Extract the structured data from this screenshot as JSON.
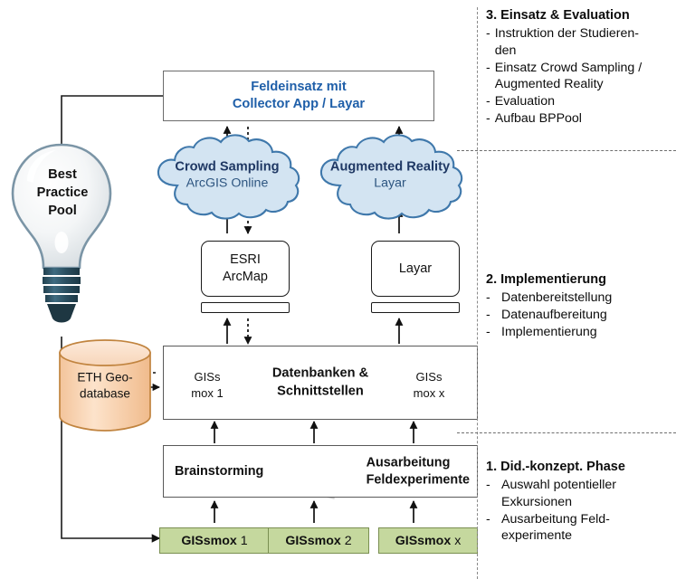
{
  "diagram": {
    "title": "GISsmox project workflow diagram",
    "colors": {
      "accent_blue": "#1f5fa9",
      "cloud_fill": "#d3e4f2",
      "cloud_stroke": "#3f78ab",
      "cloud_text": "#1f3864",
      "cylinder_fill": "#f8d3b0",
      "cylinder_stroke": "#c1843f",
      "green_fill": "#c5d89e",
      "green_stroke": "#7a8f51",
      "line": "#1a1a1a",
      "dashed": "#8a8a8a"
    }
  },
  "bulb": {
    "line1": "Best",
    "line2": "Practice",
    "line3": "Pool"
  },
  "field_box": {
    "line1": "Feldeinsatz mit",
    "line2": "Collector App / Layar",
    "icon_left": "tablet-icon",
    "icon_right": "tablet-icon"
  },
  "clouds": [
    {
      "title": "Crowd Sampling",
      "subtitle": "ArcGIS Online"
    },
    {
      "title": "Augmented Reality",
      "subtitle": "Layar"
    }
  ],
  "screens": [
    {
      "line1": "ESRI",
      "line2": "ArcMap"
    },
    {
      "line1": "Layar",
      "line2": ""
    }
  ],
  "geodb": {
    "line1": "ETH Geo-",
    "line2": "database"
  },
  "db_band": {
    "title_line1": "Datenbanken &",
    "title_line2": "Schnittstellen",
    "cylinders": [
      {
        "line1": "GISs",
        "line2": "mox 1"
      },
      {
        "line1": "GISs",
        "line2": "mox x"
      }
    ]
  },
  "brainstorm_band": {
    "left_label": "Brainstorming",
    "right_line1": "Ausarbeitung",
    "right_line2": "Feldexperimente",
    "icon": "meeting-table-icon"
  },
  "green_boxes": [
    {
      "bold": "GISsmox",
      "num": "1"
    },
    {
      "bold": "GISsmox",
      "num": "2"
    },
    {
      "bold": "GISsmox",
      "num": "x"
    }
  ],
  "phases": [
    {
      "title": "3. Einsatz & Evaluation",
      "items": [
        "Instruktion der Studieren-\nden",
        "Einsatz Crowd Sampling /\nAugmented Reality",
        "Evaluation",
        "Aufbau BPPool"
      ]
    },
    {
      "title": "2. Implementierung",
      "items": [
        "Datenbereitstellung",
        "Datenaufbereitung",
        "Implementierung"
      ]
    },
    {
      "title": "1. Did.-konzept. Phase",
      "items": [
        "Auswahl potentieller\nExkursionen",
        "Ausarbeitung Feld-\nexperimente"
      ]
    }
  ],
  "phase_text": {
    "p3_title": "3. Einsatz & Evaluation",
    "p3_i1": "Instruktion der Studieren-",
    "p3_i1b": "den",
    "p3_i2": "Einsatz Crowd Sampling /",
    "p3_i2b": "Augmented Reality",
    "p3_i3": "Evaluation",
    "p3_i4": "Aufbau BPPool",
    "p2_title": "2. Implementierung",
    "p2_i1": "Datenbereitstellung",
    "p2_i2": "Datenaufbereitung",
    "p2_i3": "Implementierung",
    "p1_title": "1. Did.-konzept. Phase",
    "p1_i1": "Auswahl potentieller",
    "p1_i1b": "Exkursionen",
    "p1_i2": "Ausarbeitung Feld-",
    "p1_i2b": "experimente",
    "dash": "-"
  }
}
